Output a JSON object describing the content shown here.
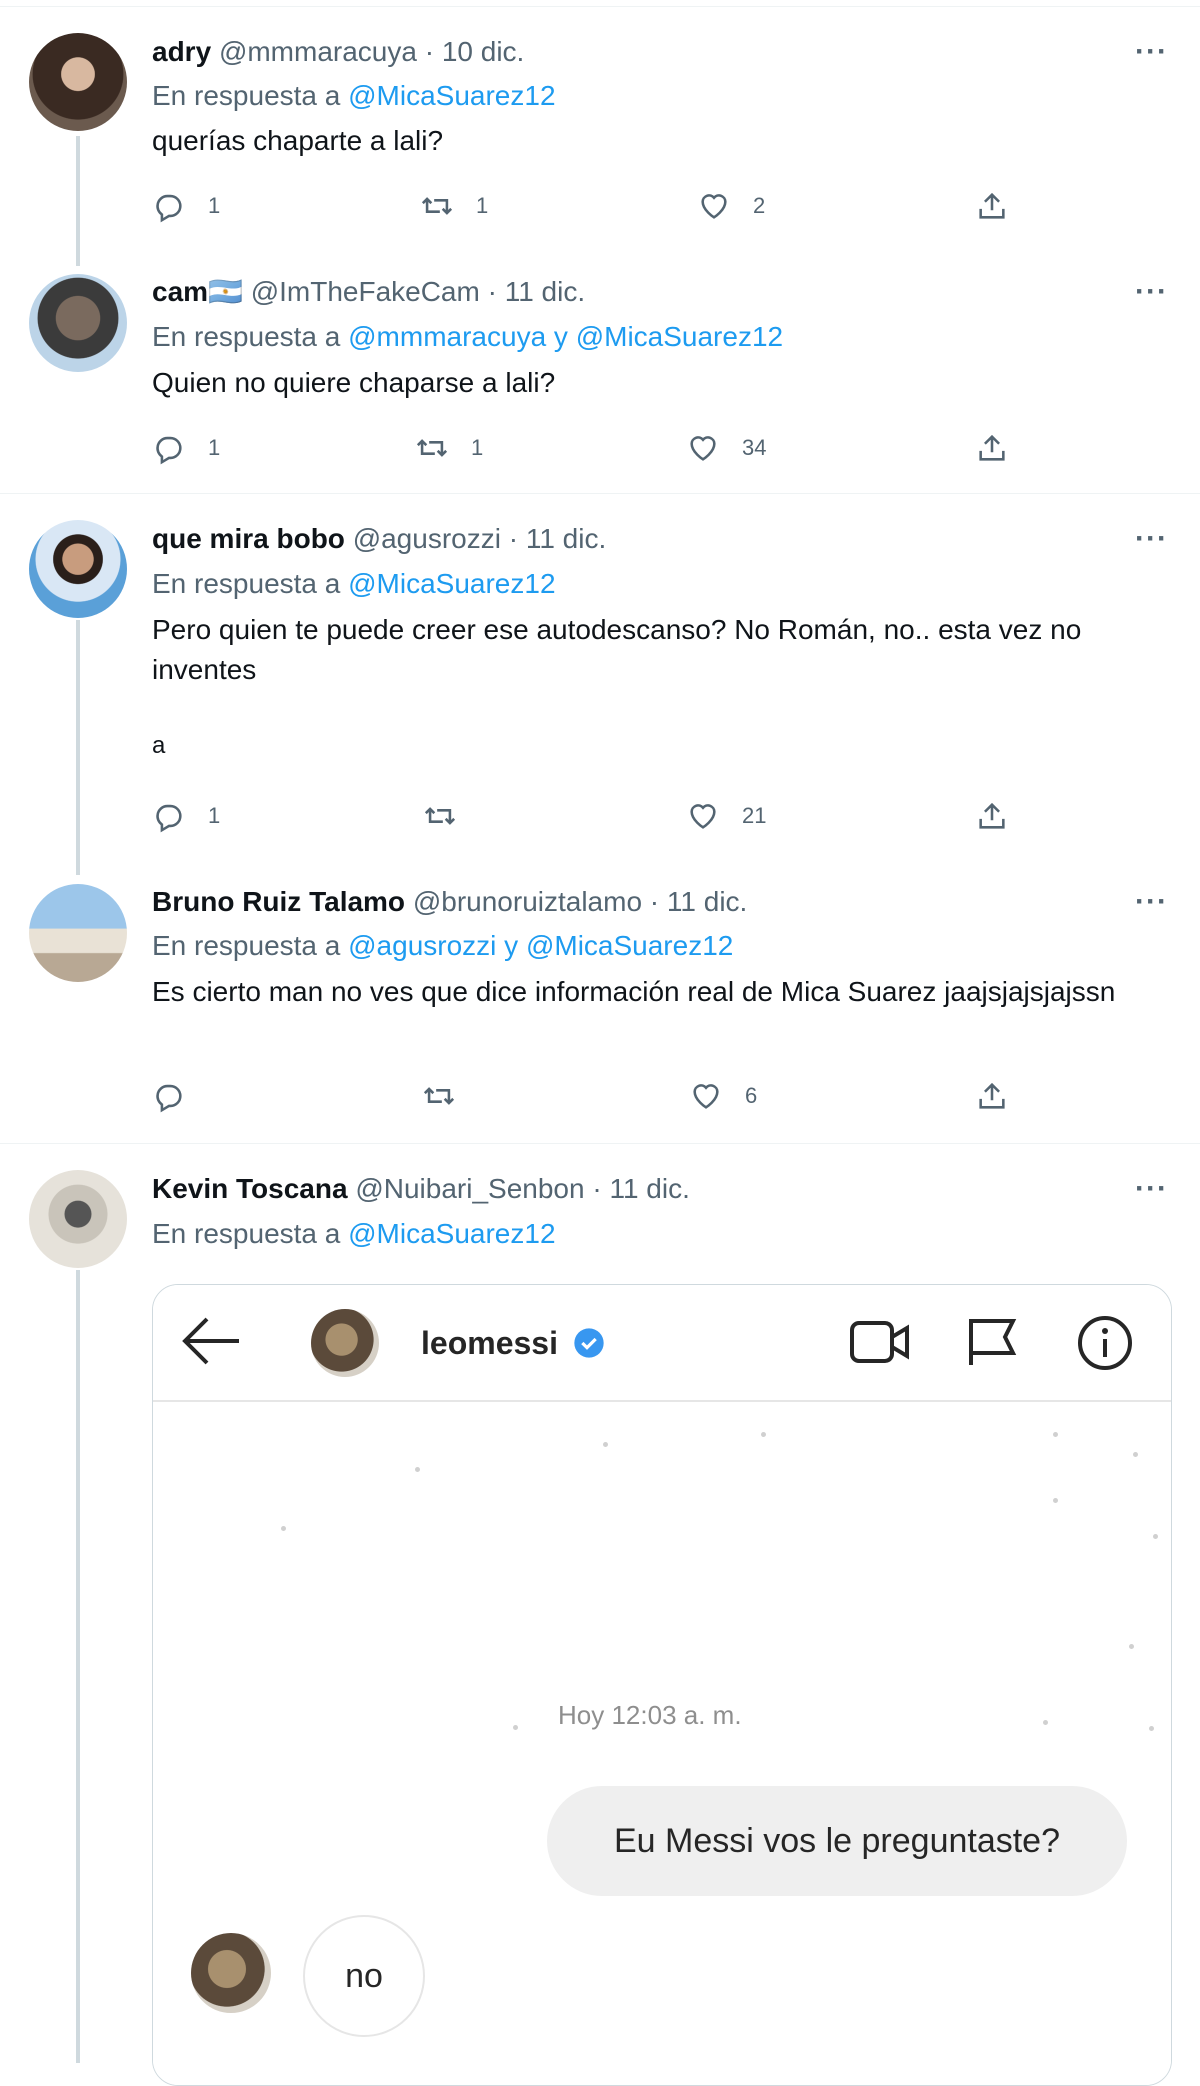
{
  "tweets": [
    {
      "name": "adry",
      "handle_date": "@mmmaracuya · 10 dic.",
      "reply_prefix": "En respuesta a ",
      "reply_to": "@MicaSuarez12",
      "text": "querías chaparte a lali?",
      "replies": "1",
      "retweets": "1",
      "likes": "2"
    },
    {
      "name": "cam🇦🇷",
      "handle_date": "@ImTheFakeCam · 11 dic.",
      "reply_prefix": "En respuesta a ",
      "reply_to": "@mmmaracuya y @MicaSuarez12",
      "text": "Quien no quiere chaparse a lali?",
      "replies": "1",
      "retweets": "1",
      "likes": "34"
    },
    {
      "name": "que mira bobo",
      "handle_date": "@agusrozzi · 11 dic.",
      "reply_prefix": "En respuesta a ",
      "reply_to": "@MicaSuarez12",
      "text": "Pero quien te puede creer ese autodescanso? No Román, no.. esta vez no inventes",
      "text_extra": "a",
      "replies": "1",
      "retweets": "",
      "likes": "21"
    },
    {
      "name": "Bruno Ruiz Talamo",
      "handle_date": "@brunoruiztalamo · 11 dic.",
      "reply_prefix": "En respuesta a ",
      "reply_to": "@agusrozzi y @MicaSuarez12",
      "text": "Es cierto man no ves que dice información real de Mica Suarez jaajsjajsjajssn",
      "replies": "",
      "retweets": "",
      "likes": "6"
    },
    {
      "name": "Kevin Toscana",
      "handle_date": "@Nuibari_Senbon · 11 dic.",
      "reply_prefix": "En respuesta a ",
      "reply_to": "@MicaSuarez12"
    }
  ],
  "more_label": "···",
  "embedded_dm": {
    "username": "leomessi",
    "timestamp": "Hoy 12:03 a. m.",
    "sent_message": "Eu Messi vos le preguntaste?",
    "received_message": "no"
  },
  "colors": {
    "link": "#1d9bf0",
    "secondary": "#536471",
    "verified": "#3897f0"
  }
}
